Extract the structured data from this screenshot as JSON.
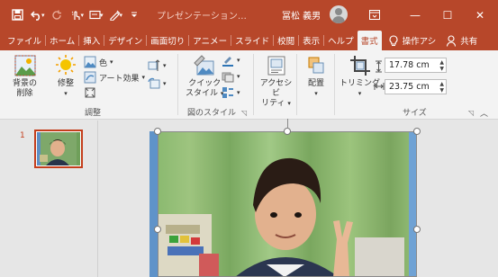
{
  "qat": {
    "save_icon": "save-icon",
    "undo_icon": "undo-icon",
    "redo_icon": "redo-icon",
    "customize_icon": "customize-qat-icon"
  },
  "window": {
    "title": "プレゼンテーション…",
    "user_name": "冨松 義男",
    "ribbon_display_icon": "ribbon-display-options-icon",
    "minimize_glyph": "—",
    "maximize_glyph": "☐",
    "close_glyph": "✕"
  },
  "tabs": [
    {
      "label": "ファイル"
    },
    {
      "label": "ホーム"
    },
    {
      "label": "挿入"
    },
    {
      "label": "デザイン"
    },
    {
      "label": "画面切り"
    },
    {
      "label": "アニメー"
    },
    {
      "label": "スライド "
    },
    {
      "label": "校閲"
    },
    {
      "label": "表示"
    },
    {
      "label": "ヘルプ"
    },
    {
      "label": "書式"
    }
  ],
  "tell_me": "操作アシ",
  "share": "共有",
  "ribbon": {
    "adjust": {
      "remove_bg_line1": "背景の",
      "remove_bg_line2": "削除",
      "corrections": "修整",
      "color": "色",
      "artistic": "アート効果",
      "label": "調整"
    },
    "styles": {
      "quick_line1": "クイック",
      "quick_line2": "スタイル",
      "label": "図のスタイル"
    },
    "accessibility": {
      "line1": "アクセシビ",
      "line2": "リティ"
    },
    "arrange": {
      "label": "配置"
    },
    "size": {
      "crop": "トリミング",
      "height": "17.78 cm",
      "width": "23.75 cm",
      "label": "サイズ"
    }
  },
  "slides": {
    "number": "1"
  },
  "colors": {
    "accent": "#b7472a",
    "ribbon_bg": "#f3f3f3",
    "workspace": "#e6e6e6"
  }
}
